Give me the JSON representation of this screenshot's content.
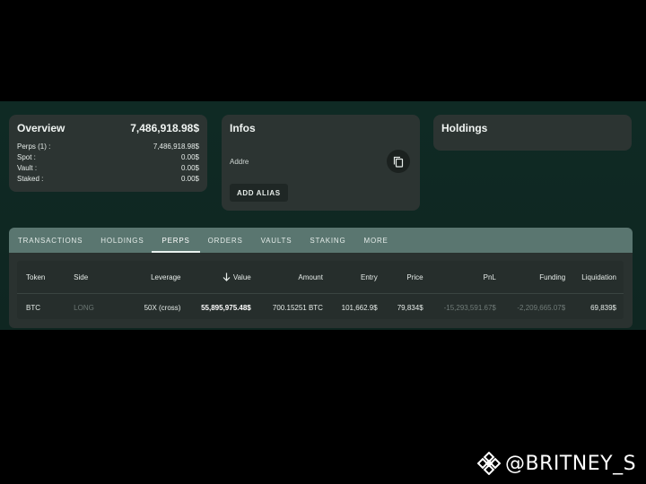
{
  "overview": {
    "title": "Overview",
    "total": "7,486,918.98$",
    "rows": [
      {
        "label": "Perps (1) :",
        "value": "7,486,918.98$"
      },
      {
        "label": "Spot :",
        "value": "0.00$"
      },
      {
        "label": "Vault :",
        "value": "0.00$"
      },
      {
        "label": "Staked :",
        "value": "0.00$"
      }
    ]
  },
  "infos": {
    "title": "Infos",
    "address_label": "Addre",
    "add_alias_label": "ADD ALIAS"
  },
  "holdings": {
    "title": "Holdings"
  },
  "tabs": [
    "TRANSACTIONS",
    "HOLDINGS",
    "PERPS",
    "ORDERS",
    "VAULTS",
    "STAKING",
    "MORE"
  ],
  "active_tab": "PERPS",
  "table": {
    "headers": {
      "token": "Token",
      "side": "Side",
      "leverage": "Leverage",
      "value": "Value",
      "amount": "Amount",
      "entry": "Entry",
      "price": "Price",
      "pnl": "PnL",
      "funding": "Funding",
      "liquidation": "Liquidation"
    },
    "rows": [
      {
        "token": "BTC",
        "side": "LONG",
        "leverage": "50X (cross)",
        "value": "55,895,975.48$",
        "amount": "700.15251 BTC",
        "entry": "101,662.9$",
        "price": "79,834$",
        "pnl": "-15,293,591.67$",
        "funding": "-2,209,665.07$",
        "liquidation": "69,839$"
      }
    ]
  },
  "watermark": {
    "handle": "@BRITNEY_S"
  },
  "colors": {
    "background": "#0f2a24",
    "card": "#2c3432",
    "tab_bar": "#5a7670",
    "table": "#262e2c"
  }
}
